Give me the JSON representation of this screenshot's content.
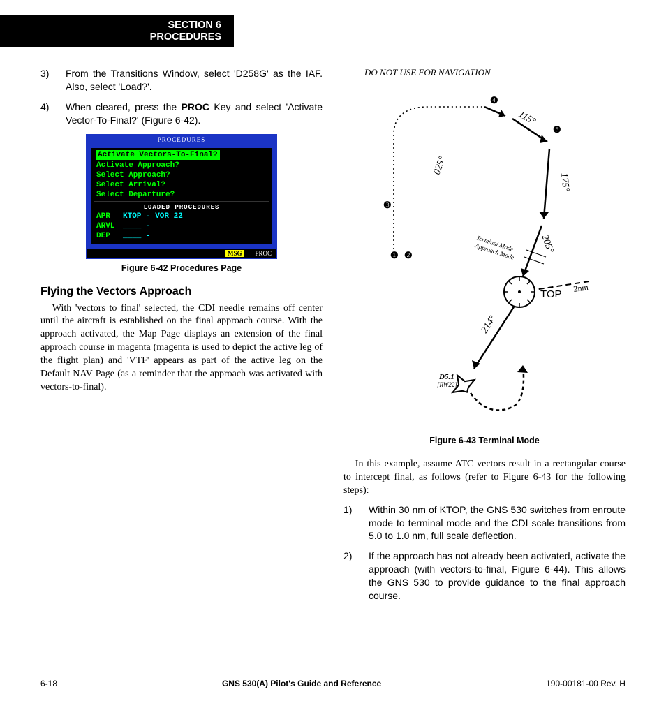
{
  "header": {
    "line1": "SECTION 6",
    "line2": "PROCEDURES"
  },
  "left": {
    "step3_num": "3)",
    "step3_txt_a": "From the Transitions Window, select 'D258G' as the IAF.  Also, select 'Load?'.",
    "step4_num": "4)",
    "step4_txt_a": "When cleared, press the ",
    "step4_bold": "PROC",
    "step4_txt_b": " Key and select 'Activate Vector-To-Final?' (Figure 6-42).",
    "fig642": {
      "title": "PROCEDURES",
      "items": [
        "Activate Vectors-To-Final?",
        "Activate Approach?",
        "Select Approach?",
        "Select Arrival?",
        "Select Departure?"
      ],
      "loaded_title": "LOADED PROCEDURES",
      "apr_lbl": "APR",
      "apr_val": "KTOP - VOR 22",
      "arvl_lbl": "ARVL",
      "arvl_val": "____ -",
      "dep_lbl": "DEP",
      "dep_val": "____ -",
      "msg": "MSG",
      "proc": "PROC"
    },
    "fig642_caption": "Figure 6-42  Procedures Page",
    "subhead": "Flying the Vectors Approach",
    "para": "With 'vectors to final' selected, the CDI needle remains off center until the aircraft is established on the final approach course.  With the approach activated, the Map Page displays an extension of the final approach course in magenta (magenta is used to depict the active leg of the flight plan) and 'VTF' appears as part of the active leg on the Default NAV Page (as a reminder that the approach was activated with vectors-to-final)."
  },
  "right": {
    "warn": "DO NOT USE FOR NAVIGATION",
    "fig643": {
      "b115": "115°",
      "b175": "175°",
      "b025": "025°",
      "b205": "205°",
      "b214": "214°",
      "top": "TOP",
      "two_nm": "2nm",
      "tm": "Terminal Mode",
      "am": "Approach Mode",
      "d51": "D5.1",
      "rw22": "[RW22]",
      "m1": "❶",
      "m2": "❷",
      "m3": "❸",
      "m4": "❹",
      "m5": "❺"
    },
    "fig643_caption": "Figure 6-43  Terminal Mode",
    "para": "In this example, assume ATC vectors result in a rectangular course to intercept final, as follows (refer to Figure 6-43 for the following steps):",
    "step1_num": "1)",
    "step1_txt": "Within 30 nm of KTOP, the GNS 530 switches from enroute mode to terminal mode and the CDI scale transitions from 5.0 to 1.0 nm, full scale deflection.",
    "step2_num": "2)",
    "step2_txt": "If the approach has not already been activated, activate the approach (with vectors-to-final, Figure 6-44).  This allows the GNS 530 to provide guidance to the final approach course."
  },
  "footer": {
    "left": "6-18",
    "mid": "GNS 530(A) Pilot's Guide and Reference",
    "right": "190-00181-00  Rev. H"
  }
}
